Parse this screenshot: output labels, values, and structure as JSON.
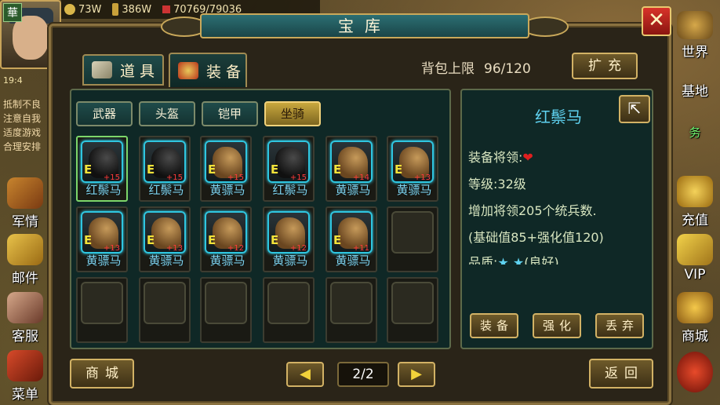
{
  "top_bar": {
    "gold": "73W",
    "silver": "386W",
    "troops": "70769/79036"
  },
  "left_hud": {
    "avatar_badge": "華",
    "clock": "19:4",
    "notice": "抵制不良\n注意自我\n适度游戏\n合理安排",
    "buttons": [
      {
        "label": "军情"
      },
      {
        "label": "邮件"
      },
      {
        "label": "客服"
      },
      {
        "label": "菜单"
      }
    ]
  },
  "right_hud": {
    "buttons": [
      {
        "label": "世界"
      },
      {
        "label": "基地"
      },
      {
        "label": "务"
      },
      {
        "label": "充值"
      },
      {
        "label": "VIP"
      },
      {
        "label": "商城"
      }
    ]
  },
  "dialog": {
    "title": "宝库",
    "close_label": "✕",
    "tabs": [
      {
        "label": "道 具",
        "active": false
      },
      {
        "label": "装 备",
        "active": true
      }
    ],
    "capacity": {
      "label": "背包上限",
      "value": "96/120"
    },
    "expand_label": "扩充",
    "categories": [
      {
        "label": "武器",
        "selected": false
      },
      {
        "label": "头盔",
        "selected": false
      },
      {
        "label": "铠甲",
        "selected": false
      },
      {
        "label": "坐骑",
        "selected": true
      }
    ],
    "items": [
      {
        "name": "红鬃马",
        "grade": "E",
        "plus": "+15",
        "color": "black",
        "selected": true
      },
      {
        "name": "红鬃马",
        "grade": "E",
        "plus": "+15",
        "color": "black",
        "selected": false
      },
      {
        "name": "黄骠马",
        "grade": "E",
        "plus": "+15",
        "color": "yellow",
        "selected": false
      },
      {
        "name": "红鬃马",
        "grade": "E",
        "plus": "+15",
        "color": "black",
        "selected": false
      },
      {
        "name": "黄骠马",
        "grade": "E",
        "plus": "+14",
        "color": "yellow",
        "selected": false
      },
      {
        "name": "黄骠马",
        "grade": "E",
        "plus": "+13",
        "color": "yellow",
        "selected": false
      },
      {
        "name": "黄骠马",
        "grade": "E",
        "plus": "+13",
        "color": "yellow",
        "selected": false
      },
      {
        "name": "黄骠马",
        "grade": "E",
        "plus": "+13",
        "color": "yellow",
        "selected": false
      },
      {
        "name": "黄骠马",
        "grade": "E",
        "plus": "+12",
        "color": "yellow",
        "selected": false
      },
      {
        "name": "黄骠马",
        "grade": "E",
        "plus": "+12",
        "color": "yellow",
        "selected": false
      },
      {
        "name": "黄骠马",
        "grade": "E",
        "plus": "+11",
        "color": "yellow",
        "selected": false
      }
    ],
    "detail": {
      "title": "红鬃马",
      "equipper_label": "装备将领:",
      "level_label": "等级:32级",
      "effect": "增加将领205个统兵数.",
      "breakdown": "(基础值85+强化值120)",
      "quality_label": "品质:",
      "quality_stars": "★ ★",
      "quality_text": "(良好)",
      "actions": [
        "装备",
        "强化",
        "丢弃"
      ]
    },
    "footer": {
      "shop_label": "商城",
      "prev_label": "◀",
      "page": "2/2",
      "next_label": "▶",
      "back_label": "返回"
    }
  },
  "colors": {
    "accent_gold": "#d2b265",
    "item_name": "#7fd6f2",
    "teal_panel": "#0f2826",
    "plus_red": "#ff3b3b"
  }
}
